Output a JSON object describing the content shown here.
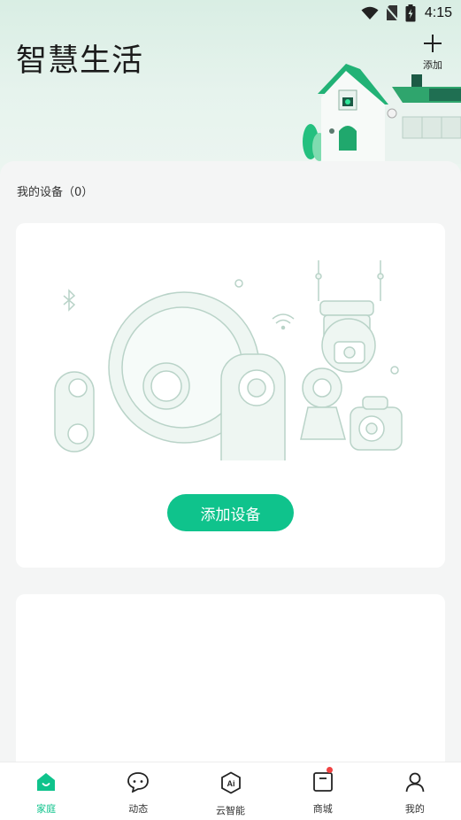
{
  "status_bar": {
    "time": "4:15",
    "icons": [
      "wifi-icon",
      "no-sim-icon",
      "battery-charging-icon"
    ]
  },
  "header": {
    "title": "智慧生活",
    "add_label": "添加"
  },
  "devices": {
    "section_label": "我的设备（0）",
    "add_device_label": "添加设备"
  },
  "tabbar": {
    "items": [
      {
        "label": "家庭",
        "icon": "home-icon",
        "active": true
      },
      {
        "label": "动态",
        "icon": "chat-bubble-icon",
        "active": false
      },
      {
        "label": "云智能",
        "icon": "ai-hexagon-icon",
        "active": false
      },
      {
        "label": "商城",
        "icon": "store-icon",
        "active": false,
        "badge": true
      },
      {
        "label": "我的",
        "icon": "person-icon",
        "active": false
      }
    ]
  },
  "colors": {
    "accent": "#0fc38c",
    "badge": "#f04242",
    "header_bg": "#d9eee4"
  }
}
